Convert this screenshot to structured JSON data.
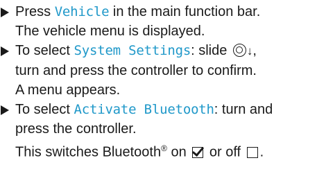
{
  "steps": [
    {
      "line1_pre": "Press ",
      "line1_hl": "Vehicle",
      "line1_post": " in the main function bar.",
      "line2": "The vehicle menu is displayed."
    },
    {
      "line1_pre": "To select ",
      "line1_hl": "System Settings",
      "line1_post": ": slide ",
      "line1_arrow": "↓",
      "line1_end": ",",
      "line2": "turn and press the controller to confirm.",
      "line3": "A menu appears."
    },
    {
      "line1_pre": "To select ",
      "line1_hl": "Activate Bluetooth",
      "line1_post": ": turn and",
      "line2": "press the controller.",
      "line3_pre": "This switches Bluetooth",
      "line3_reg": "®",
      "line3_mid": " on ",
      "line3_mid2": " or off ",
      "line3_end": "."
    }
  ],
  "icons": {
    "controller": "controller-icon",
    "arrow": "arrow-down-icon",
    "checked": "checkbox-checked-icon",
    "unchecked": "checkbox-unchecked-icon"
  }
}
